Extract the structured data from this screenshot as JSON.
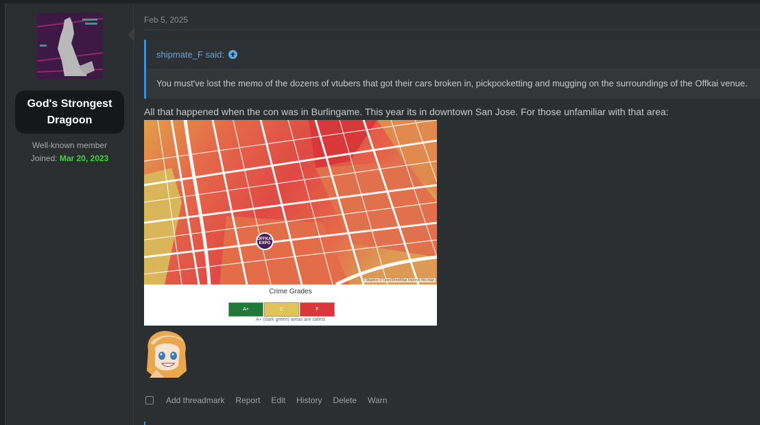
{
  "user": {
    "name": "God's Strongest Dragoon",
    "title": "Well-known member",
    "joined_label": "Joined:",
    "joined_date": "Mar 20, 2023"
  },
  "post": {
    "date": "Feb 5, 2025",
    "quote": {
      "author": "shipmate_F said:",
      "text": "You must've lost the memo of the dozens of vtubers that got their cars broken in, pickpocketting and mugging on the surroundings of the Offkai venue."
    },
    "body": "All that happened when the con was in Burlingame. This year its in downtown San Jose. For those unfamiliar with that area:",
    "map": {
      "legend_title": "Crime Grades",
      "grades": [
        {
          "label": "A+",
          "color": "#1f7a3a"
        },
        {
          "label": "C",
          "color": "#e0c35a"
        },
        {
          "label": "F",
          "color": "#d9383a"
        }
      ],
      "legend_note": "A+ (dark green) areas are safest",
      "attribution": "© Mapbox © OpenStreetMap Improve this map",
      "pin_label": "OFFKAI EXPO"
    }
  },
  "actions": {
    "items": [
      "Add threadmark",
      "Report",
      "Edit",
      "History",
      "Delete",
      "Warn"
    ]
  }
}
